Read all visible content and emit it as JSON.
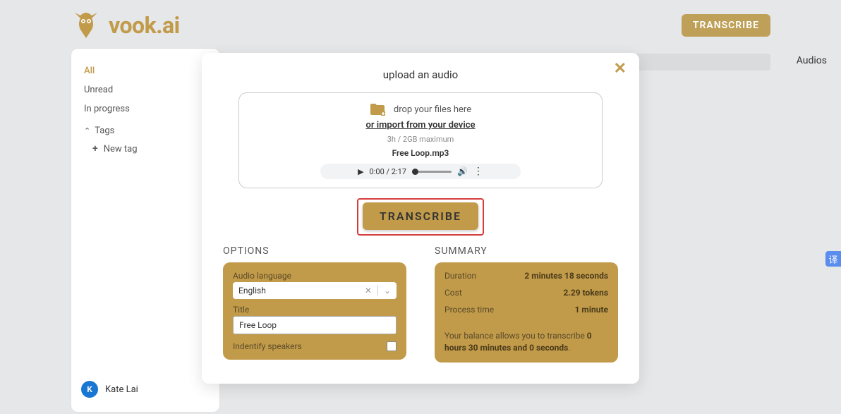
{
  "header": {
    "brand": "vook.ai",
    "transcribe_btn": "TRANSCRIBE"
  },
  "sidebar": {
    "items": [
      {
        "label": "All",
        "active": true
      },
      {
        "label": "Unread",
        "active": false
      },
      {
        "label": "In progress",
        "active": false
      }
    ],
    "tags_label": "Tags",
    "new_tag_label": "New tag",
    "user_initial": "K",
    "user_name": "Kate Lai"
  },
  "tabs": {
    "audios": "Audios"
  },
  "modal": {
    "title": "upload an audio",
    "drop_text": "drop your files here",
    "import_link": "or import from your device",
    "limit_text": "3h / 2GB maximum",
    "filename": "Free Loop.mp3",
    "time_text": "0:00 / 2:17",
    "transcribe_btn": "TRANSCRIBE",
    "options": {
      "title": "OPTIONS",
      "lang_label": "Audio language",
      "lang_value": "English",
      "title_label": "Title",
      "title_value": "Free Loop",
      "speakers_label": "Indentify speakers"
    },
    "summary": {
      "title": "SUMMARY",
      "duration_label": "Duration",
      "duration_value": "2 minutes 18 seconds",
      "cost_label": "Cost",
      "cost_value": "2.29 tokens",
      "time_label": "Process time",
      "time_value": "1 minute",
      "balance_prefix": "Your balance allows you to transcribe ",
      "balance_hours": "0 hours 30 minutes and 0 seconds",
      "balance_suffix": "."
    }
  }
}
